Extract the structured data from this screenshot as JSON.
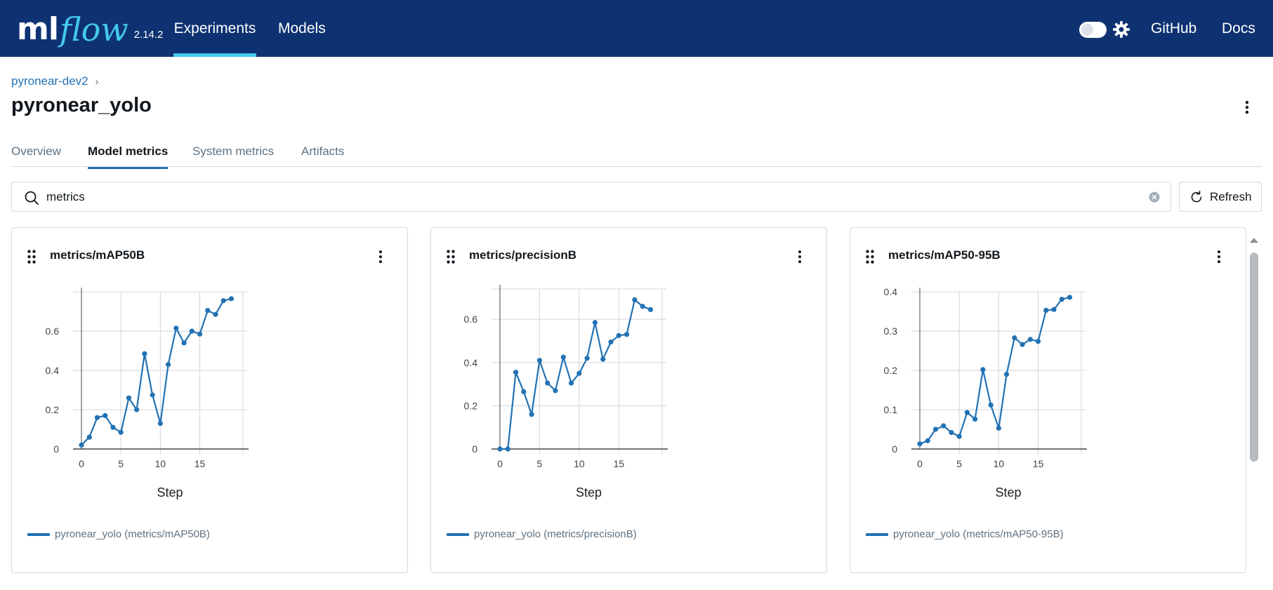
{
  "header": {
    "logo_ml": "ml",
    "logo_flow": "flow",
    "version": "2.14.2",
    "nav": [
      {
        "label": "Experiments",
        "active": true
      },
      {
        "label": "Models",
        "active": false
      }
    ],
    "github_label": "GitHub",
    "docs_label": "Docs",
    "icons": {
      "theme_toggle": "toggle-switch",
      "settings": "gear-icon"
    },
    "colors": {
      "bar": "#0e3271",
      "accent": "#43c9ed"
    }
  },
  "breadcrumb": {
    "parent": "pyronear-dev2"
  },
  "page": {
    "title": "pyronear_yolo"
  },
  "tabs": [
    {
      "label": "Overview",
      "active": false
    },
    {
      "label": "Model metrics",
      "active": true
    },
    {
      "label": "System metrics",
      "active": false
    },
    {
      "label": "Artifacts",
      "active": false
    }
  ],
  "search": {
    "value": "metrics",
    "placeholder": ""
  },
  "refresh_label": "Refresh",
  "chart_data": [
    {
      "type": "line",
      "title": "metrics/mAP50B",
      "xlabel": "Step",
      "ylabel": "",
      "x": [
        0,
        1,
        2,
        3,
        4,
        5,
        6,
        7,
        8,
        9,
        10,
        11,
        12,
        13,
        14,
        15,
        16,
        17,
        18,
        19
      ],
      "xticks": [
        0,
        5,
        10,
        15
      ],
      "ylim": [
        0,
        0.8
      ],
      "yticks": [
        0,
        0.2,
        0.4,
        0.6
      ],
      "ytick_labels": [
        "0",
        "0.2",
        "0.4",
        "0.6"
      ],
      "grid": true,
      "legend_position": "bottom-left",
      "series": [
        {
          "name": "pyronear_yolo (metrics/mAP50B)",
          "color": "#2272b4",
          "values": [
            0.02,
            0.06,
            0.16,
            0.17,
            0.11,
            0.085,
            0.26,
            0.2,
            0.485,
            0.275,
            0.13,
            0.43,
            0.615,
            0.54,
            0.6,
            0.585,
            0.705,
            0.685,
            0.755,
            0.765
          ]
        }
      ]
    },
    {
      "type": "line",
      "title": "metrics/precisionB",
      "xlabel": "Step",
      "ylabel": "",
      "x": [
        0,
        1,
        2,
        3,
        4,
        5,
        6,
        7,
        8,
        9,
        10,
        11,
        12,
        13,
        14,
        15,
        16,
        17,
        18,
        19
      ],
      "xticks": [
        0,
        5,
        10,
        15
      ],
      "ylim": [
        0,
        0.74
      ],
      "yticks": [
        0,
        0.2,
        0.4,
        0.6
      ],
      "ytick_labels": [
        "0",
        "0.2",
        "0.4",
        "0.6"
      ],
      "grid": true,
      "legend_position": "bottom-left",
      "series": [
        {
          "name": "pyronear_yolo (metrics/precisionB)",
          "color": "#2272b4",
          "values": [
            0,
            0,
            0.355,
            0.265,
            0.16,
            0.41,
            0.305,
            0.27,
            0.425,
            0.305,
            0.35,
            0.42,
            0.585,
            0.415,
            0.495,
            0.525,
            0.53,
            0.69,
            0.66,
            0.645
          ]
        }
      ]
    },
    {
      "type": "line",
      "title": "metrics/mAP50-95B",
      "xlabel": "Step",
      "ylabel": "",
      "x": [
        0,
        1,
        2,
        3,
        4,
        5,
        6,
        7,
        8,
        9,
        10,
        11,
        12,
        13,
        14,
        15,
        16,
        17,
        18,
        19
      ],
      "xticks": [
        0,
        5,
        10,
        15
      ],
      "ylim": [
        0,
        0.4
      ],
      "yticks": [
        0,
        0.1,
        0.2,
        0.3,
        0.4
      ],
      "ytick_labels": [
        "0",
        "0.1",
        "0.2",
        "0.3",
        "0.4"
      ],
      "grid": true,
      "legend_position": "bottom-left",
      "series": [
        {
          "name": "pyronear_yolo (metrics/mAP50-95B)",
          "color": "#2272b4",
          "values": [
            0.013,
            0.021,
            0.05,
            0.059,
            0.042,
            0.032,
            0.093,
            0.076,
            0.202,
            0.112,
            0.053,
            0.19,
            0.283,
            0.266,
            0.279,
            0.274,
            0.353,
            0.355,
            0.381,
            0.386
          ]
        }
      ]
    }
  ]
}
